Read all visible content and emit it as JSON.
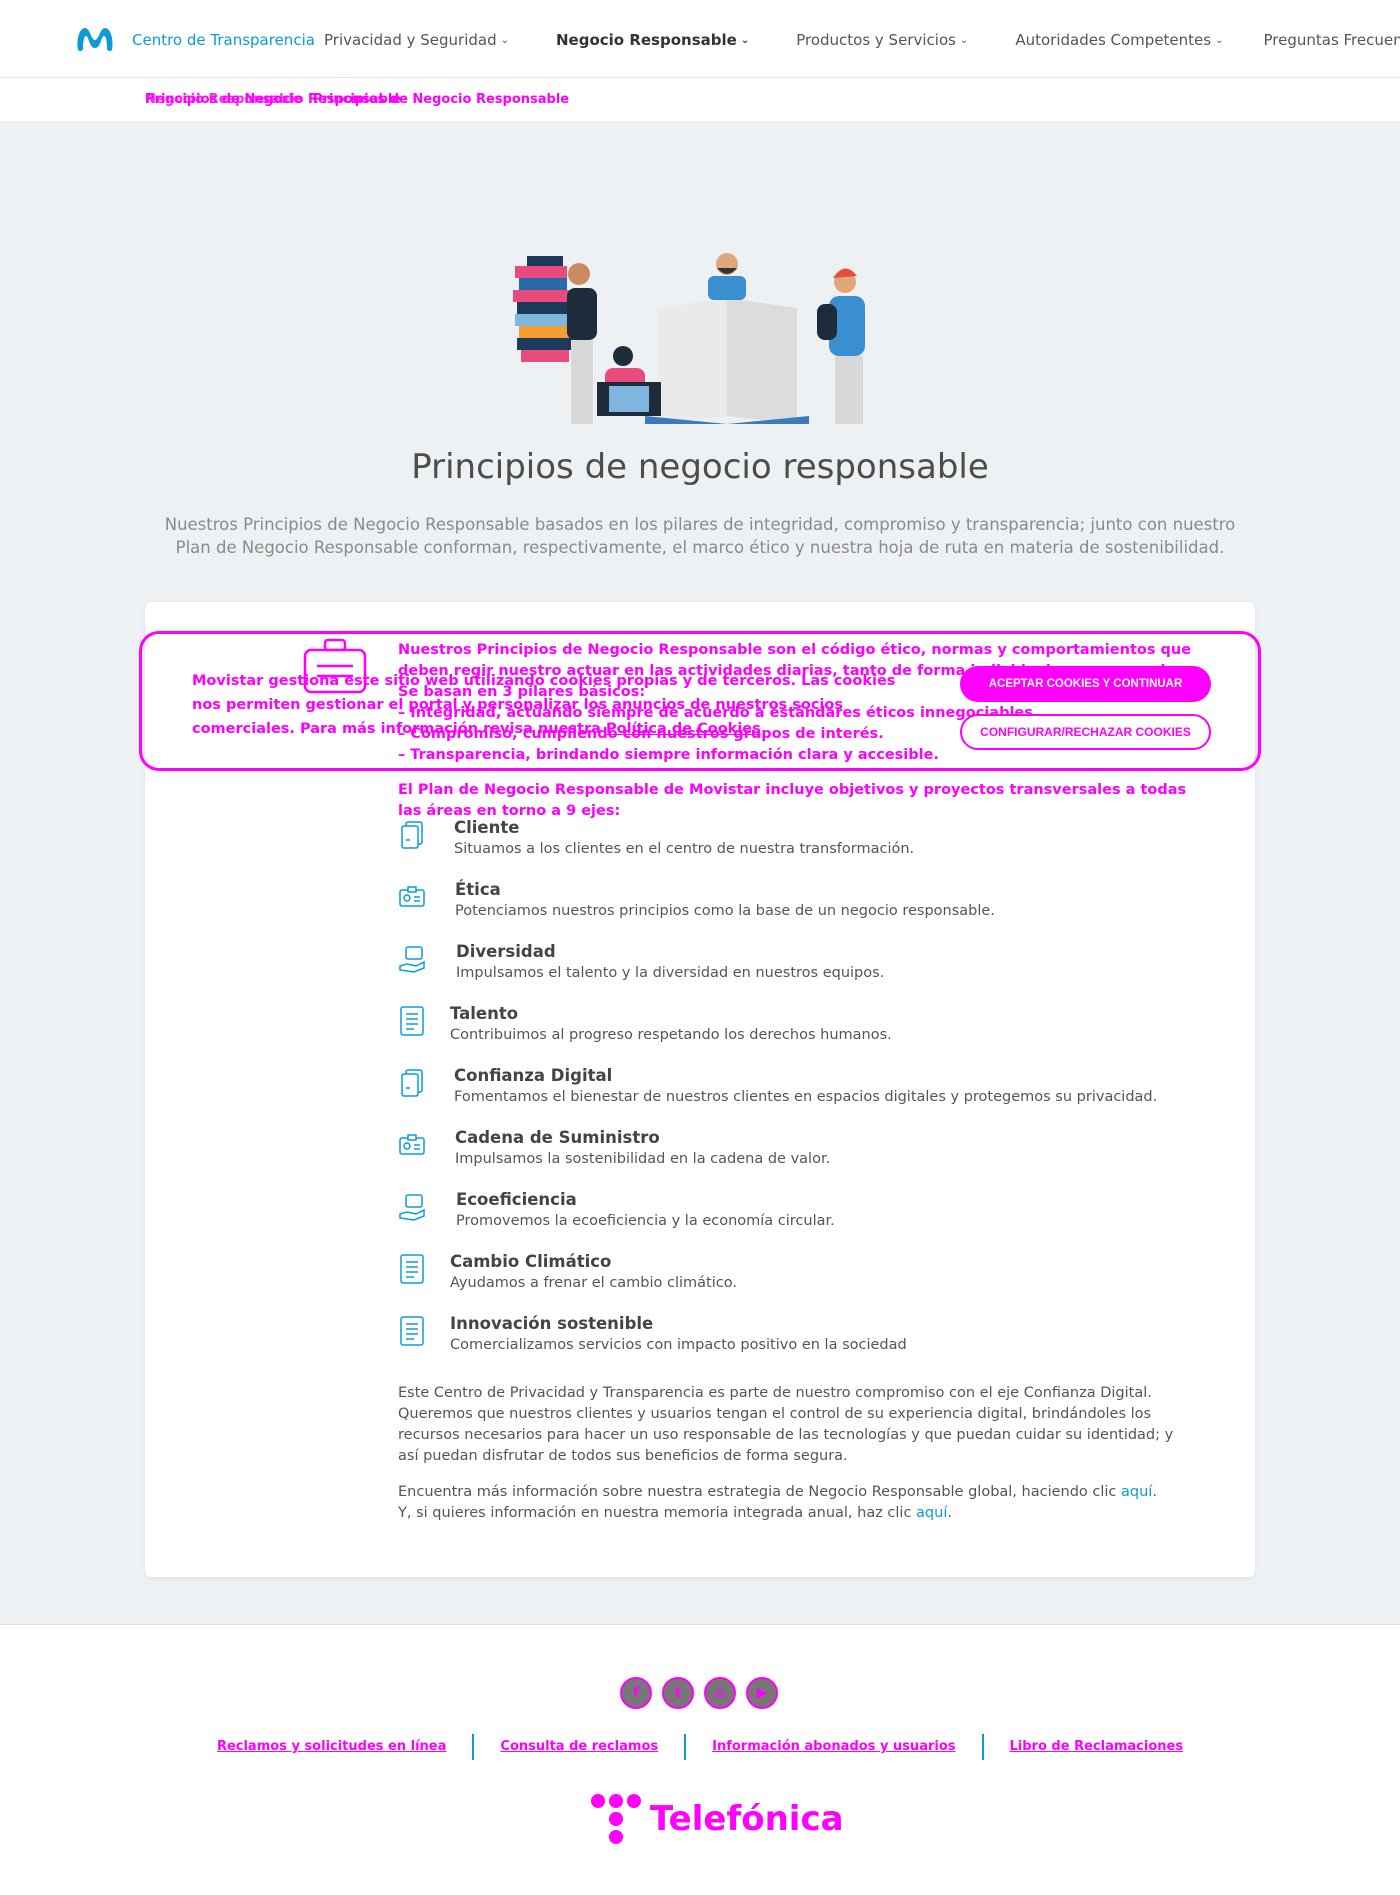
{
  "header": {
    "brand": "Centro de Transparencia",
    "nav": [
      {
        "label": "Privacidad y Seguridad",
        "dropdown": true,
        "active": false
      },
      {
        "label": "Negocio Responsable",
        "dropdown": true,
        "active": true
      },
      {
        "label": "Productos y Servicios",
        "dropdown": true,
        "active": false
      },
      {
        "label": "Autoridades Competentes",
        "dropdown": true,
        "active": false
      },
      {
        "label": "Preguntas Frecuentes",
        "dropdown": false,
        "active": false
      }
    ]
  },
  "breadcrumb": {
    "text_a": "Negocio Responsable",
    "text_b": "Principios de Negocio Responsable"
  },
  "hero": {
    "title": "Principios de negocio responsable",
    "subtitle": "Nuestros Principios de Negocio Responsable basados en los pilares de integridad, compromiso y transparencia; junto con nuestro Plan de Negocio Responsable conforman, respectivamente, el marco ético y nuestra hoja de ruta en materia de sostenibilidad."
  },
  "content": {
    "intro": "Nuestros Principios de Negocio Responsable son el código ético, normas y comportamientos que deben regir nuestro actuar en las actividades diarias, tanto de forma individual como en equipo. Se basan en 3 pilares básicos:",
    "bullet_1": "– Integridad, actuando siempre de acuerdo a estándares éticos innegociables.",
    "bullet_2": "– Compromiso, cumpliendo con nuestros grupos de interés.",
    "bullet_3": "– Transparencia, brindando siempre información clara y accesible.",
    "plan": "El Plan de Negocio Responsable de Movistar incluye objetivos y proyectos transversales a todas las áreas en torno a 9 ejes:"
  },
  "pillars": [
    {
      "title": "Cliente",
      "desc": "Situamos a los clientes en el centro de nuestra transformación.",
      "icon": "documents-icon"
    },
    {
      "title": "Ética",
      "desc": "Potenciamos nuestros principios como la base de un negocio responsable.",
      "icon": "id-card-icon"
    },
    {
      "title": "Diversidad",
      "desc": "Impulsamos el talento y la diversidad en nuestros equipos.",
      "icon": "hand-care-icon"
    },
    {
      "title": "Talento",
      "desc": "Contribuimos al progreso respetando los derechos humanos.",
      "icon": "document-icon"
    },
    {
      "title": "Confianza Digital",
      "desc": "Fomentamos el bienestar de nuestros clientes en espacios digitales y protegemos su privacidad.",
      "icon": "documents-icon"
    },
    {
      "title": "Cadena de Suministro",
      "desc": "Impulsamos la sostenibilidad en la cadena de valor.",
      "icon": "id-card-icon"
    },
    {
      "title": "Ecoeficiencia",
      "desc": "Promovemos la ecoeficiencia y la economía circular.",
      "icon": "hand-care-icon"
    },
    {
      "title": "Cambio Climático",
      "desc": "Ayudamos a frenar el cambio climático.",
      "icon": "document-icon"
    },
    {
      "title": "Innovación sostenible",
      "desc": "Comercializamos servicios con impacto positivo en la sociedad",
      "icon": "document-icon"
    }
  ],
  "closing": {
    "p1": "Este Centro de Privacidad y Transparencia es parte de nuestro compromiso con el eje Confianza Digital. Queremos que nuestros clientes y usuarios tengan el control de su experiencia digital, brindándoles los recursos necesarios para hacer un uso responsable de las tecnologías y que puedan cuidar su identidad; y así puedan disfrutar de todos sus beneficios de forma segura.",
    "p2_text": "Encuentra más información sobre nuestra estrategia de Negocio Responsable global, haciendo clic ",
    "p2_link": "aquí",
    "p3_text": "Y, si quieres información en nuestra memoria integrada anual, haz clic ",
    "p3_link": "aquí"
  },
  "cookie": {
    "text": "Movistar gestiona este sitio web utilizando cookies propias y de terceros. Las cookies nos permiten gestionar el portal y personalizar los anuncios de nuestros socios comerciales. Para más información revisa nuestra ",
    "link": "Política de Cookies",
    "accept": "ACEPTAR COOKIES Y CONTINUAR",
    "configure": "CONFIGURAR/RECHAZAR COOKIES"
  },
  "footer": {
    "socials": [
      "facebook-icon",
      "twitter-icon",
      "instagram-icon",
      "youtube-icon"
    ],
    "links": [
      "Reclamos y solicitudes en línea",
      "Consulta de reclamos",
      "Información abonados y usuarios",
      "Libro de Reclamaciones"
    ],
    "company": "Telefónica"
  },
  "colors": {
    "accent": "#0b9bd9",
    "highlight": "#ff00ff",
    "hero_bg": "#edf1f4"
  }
}
